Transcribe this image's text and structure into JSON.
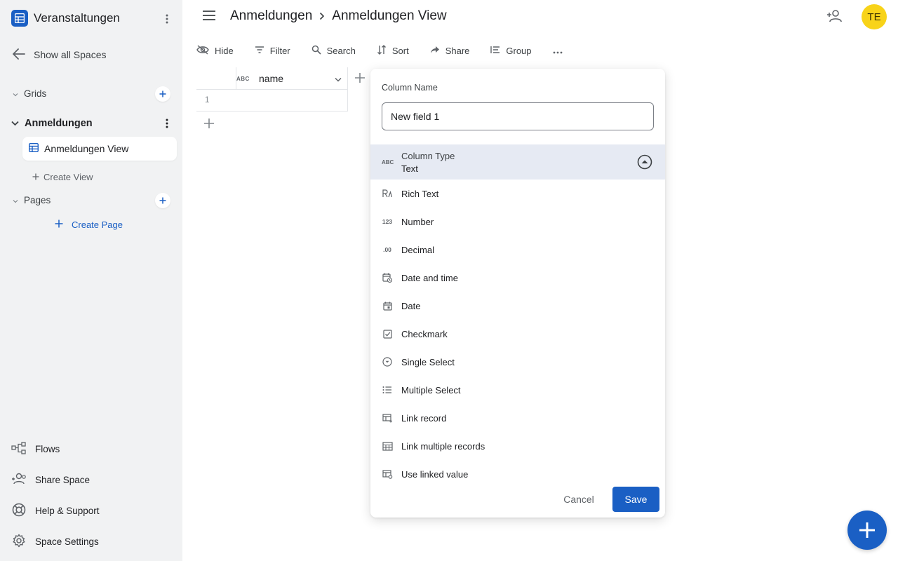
{
  "sidebar": {
    "space_title": "Veranstaltungen",
    "show_all_spaces": "Show all Spaces",
    "grids_label": "Grids",
    "table_name": "Anmeldungen",
    "view_name": "Anmeldungen View",
    "create_view": "Create View",
    "pages_label": "Pages",
    "create_page": "Create Page",
    "bottom": {
      "flows": "Flows",
      "share_space": "Share Space",
      "help": "Help & Support",
      "settings": "Space Settings"
    }
  },
  "header": {
    "crumb_table": "Anmeldungen",
    "crumb_view": "Anmeldungen View",
    "avatar_initials": "TE"
  },
  "toolbar": {
    "hide": "Hide",
    "filter": "Filter",
    "search": "Search",
    "sort": "Sort",
    "share": "Share",
    "group": "Group"
  },
  "grid": {
    "column_type_badge": "ABC",
    "column_name": "name",
    "row_number": "1"
  },
  "popup": {
    "column_name_label": "Column Name",
    "column_name_value": "New field 1",
    "column_type_label": "Column Type",
    "column_type_value": "Text",
    "type_icon_abc": "ABC",
    "type_icon_number": "123",
    "type_icon_decimal": ".00",
    "types": [
      "Rich Text",
      "Number",
      "Decimal",
      "Date and time",
      "Date",
      "Checkmark",
      "Single Select",
      "Multiple Select",
      "Link record",
      "Link multiple records",
      "Use linked value"
    ],
    "cancel": "Cancel",
    "save": "Save"
  },
  "colors": {
    "accent": "#1a5fc4",
    "sidebar_bg": "#f1f2f3",
    "selected_type_bg": "#e6eaf3",
    "avatar_bg": "#f8d319"
  }
}
